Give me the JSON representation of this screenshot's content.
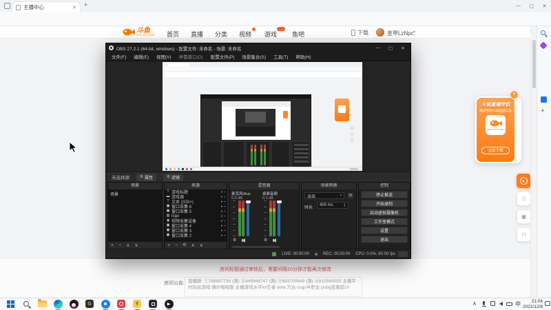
{
  "icons": {
    "back": "←",
    "refresh": "⟳",
    "more": "⋯",
    "newtab": "+",
    "star": "☆",
    "min": "—",
    "max": "▢",
    "close": "✕",
    "caret": "▾",
    "plus": "+",
    "minus": "−",
    "up": "∧",
    "down": "∨",
    "gear": "⚙",
    "eye": "●",
    "lock": "▪",
    "play": "▶",
    "home": "⌂",
    "headset": "∩",
    "chevron_up": "∧"
  },
  "browser": {
    "tab_title": "主播中心",
    "url": "https://mp.douyu.com/live/main"
  },
  "douyu": {
    "logo_text": "斗鱼",
    "logo_sub": "DOUYU.COM",
    "nav": [
      {
        "label": "首页"
      },
      {
        "label": "直播"
      },
      {
        "label": "分类"
      },
      {
        "label": "视频",
        "badge": "dot"
      },
      {
        "label": "游戏",
        "badge": "pill"
      },
      {
        "label": "鱼吧"
      }
    ],
    "download_label": "下载",
    "username": "金甲LzNpc"
  },
  "obs": {
    "window_title": "OBS 27.2.1 (64-bit, windows) - 配置文件: 未命名 - 场景: 未命名",
    "menus": [
      "文件(F)",
      "编辑(E)",
      "视图(V)",
      "停靠窗口(D)",
      "配置文件(P)",
      "场景集合(S)",
      "工具(T)",
      "帮助(H)"
    ],
    "source_toolbar": {
      "status": "未选择源",
      "properties": "属性",
      "filters": "滤镜"
    },
    "scenes": {
      "title": "场景",
      "items": [
        "场景"
      ]
    },
    "sources": {
      "title": "来源",
      "items": [
        {
          "glyph": "T",
          "label": "游戏标题"
        },
        {
          "glyph": "▬",
          "label": "游戏源"
        },
        {
          "glyph": "T",
          "label": "文本 (GDI+)"
        },
        {
          "glyph": "▣",
          "label": "窗口采集 6"
        },
        {
          "glyph": "▣",
          "label": "窗口采集 5"
        },
        {
          "glyph": "▨",
          "label": "logo"
        },
        {
          "glyph": "◉",
          "label": "视频采集设备"
        },
        {
          "glyph": "▣",
          "label": "窗口采集 4"
        },
        {
          "glyph": "▣",
          "label": "窗口采集 3"
        },
        {
          "glyph": "▣",
          "label": "窗口采集 2"
        }
      ]
    },
    "mixer": {
      "title": "混音器",
      "channels": [
        {
          "name": "麦克风/Aux",
          "level": "0.0 dB"
        },
        {
          "name": "桌面音频",
          "level": "0.0 dB"
        }
      ]
    },
    "transitions": {
      "title": "场景转换",
      "selected": "淡出",
      "duration_label": "时长",
      "duration_value": "400 ms"
    },
    "controls": {
      "title": "控制",
      "buttons": [
        "停止推流",
        "开始录制",
        "启动虚拟摄像机",
        "工作室模式",
        "设置",
        "退出"
      ]
    },
    "status": {
      "live": "LIVE: 00:00:00",
      "rec": "REC: 00:00:00",
      "cpu": "CPU: 0.0%, 60.00 fps"
    }
  },
  "page": {
    "warning": "房间标题通过审核后，需要间隔10分钟才能再次修改",
    "announcement_label": "房间公告:",
    "announcement_text": "直播群: ①768687736 (满) ②849968747 (满) ③683700849 (满) ④810569055 主播平时玩玩游戏 偶尔唱唱歌 主播游戏水平lol王者 dota 万古 csgo半职业 pubg亚服前10"
  },
  "banner": {
    "title": "斗鱼直播伴侣",
    "subtitle": "最好用的PC端直播工具",
    "cta": "立即下载"
  },
  "taskbar": {
    "time": "21:04",
    "date": "2022/12/8",
    "ime": "中"
  }
}
